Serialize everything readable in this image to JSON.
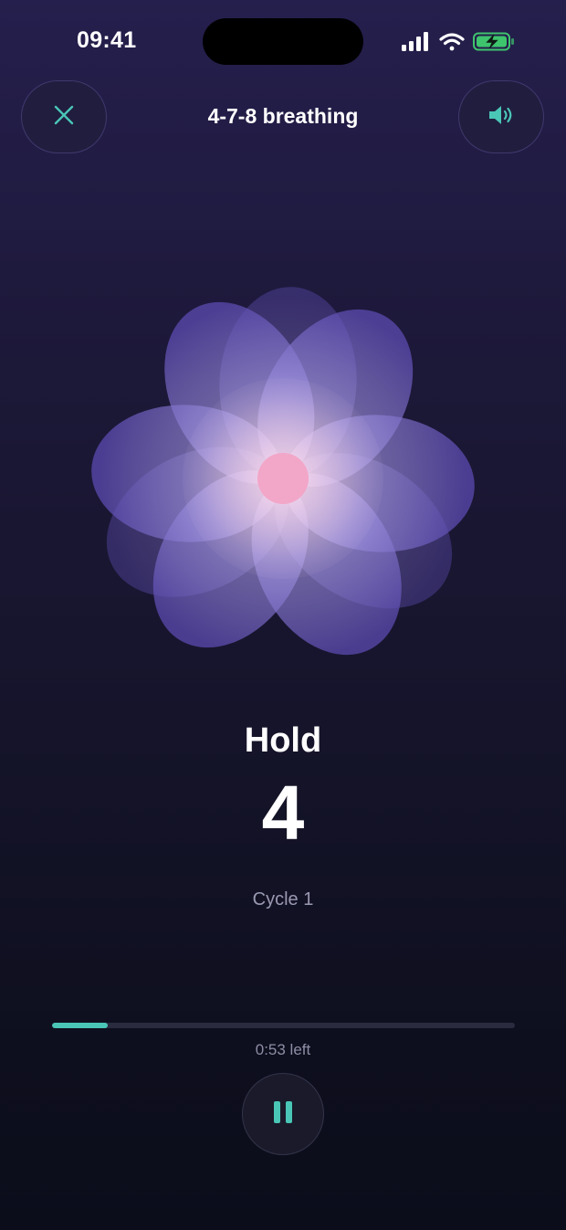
{
  "status_bar": {
    "time": "09:41",
    "icons": [
      "signal-icon",
      "wifi-icon",
      "battery-charging-icon"
    ]
  },
  "header": {
    "title": "4-7-8 breathing",
    "close_icon": "close-icon",
    "sound_icon": "speaker-icon"
  },
  "session": {
    "phase": "Hold",
    "count": "4",
    "cycle_label": "Cycle 1",
    "progress_fraction": 0.12,
    "time_left": "0:53 left"
  },
  "controls": {
    "pause_icon": "pause-icon"
  },
  "colors": {
    "accent": "#4ac6b6",
    "petal": "#7a6bc8",
    "center": "#f2a6c8",
    "battery": "#3ec46d"
  }
}
